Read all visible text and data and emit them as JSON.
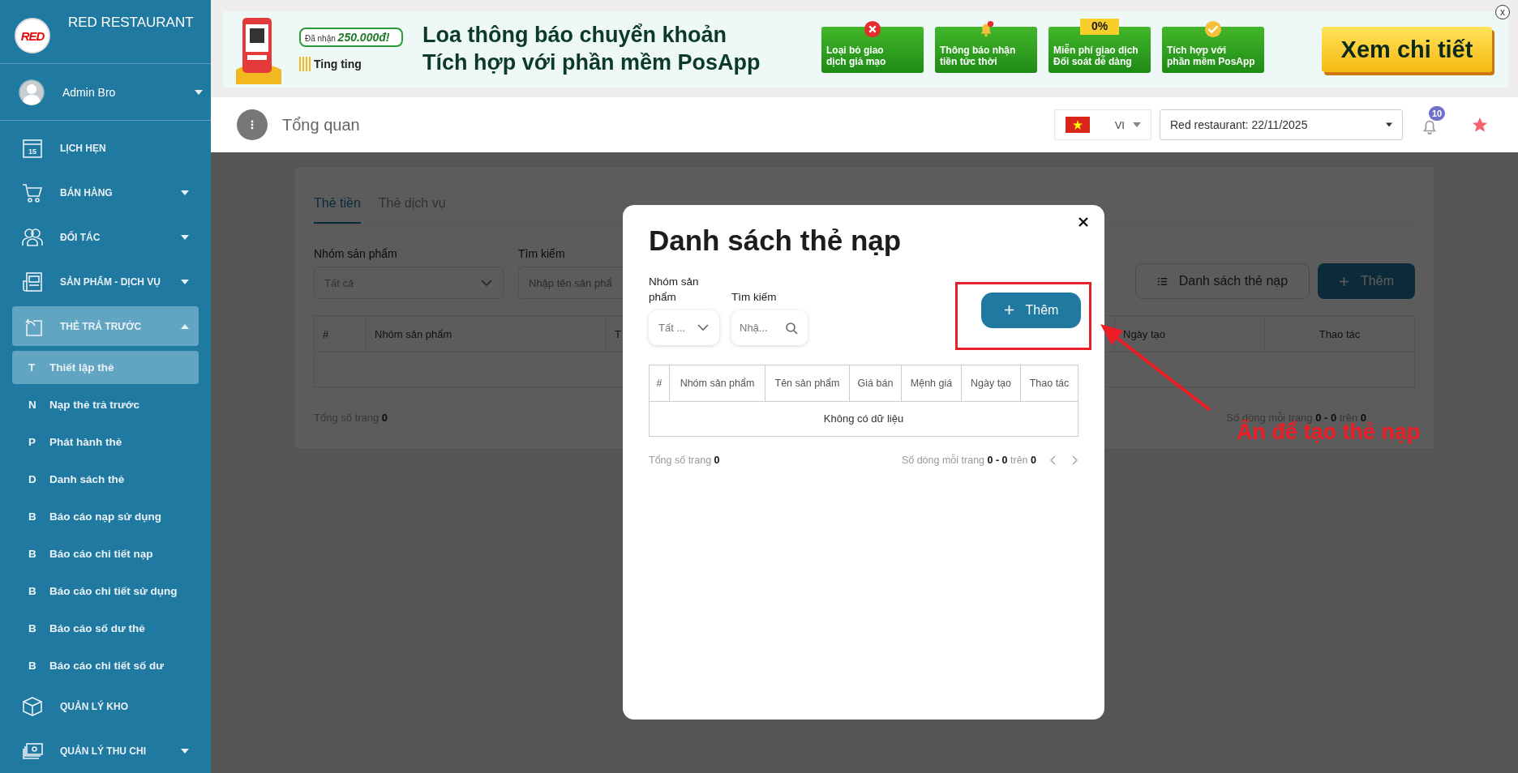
{
  "sidebar": {
    "logo": "RED",
    "brand": "RED RESTAURANT",
    "user": {
      "name": "Admin Bro"
    },
    "items": [
      {
        "kind": "link",
        "label": "LỊCH HẸN",
        "icon_text": "15",
        "selected": false
      },
      {
        "kind": "group",
        "label": "BÁN HÀNG",
        "expanded": false,
        "selected": false
      },
      {
        "kind": "group",
        "label": "ĐỐI TÁC",
        "expanded": false,
        "selected": false
      },
      {
        "kind": "group",
        "label": "SẢN PHẨM - DỊCH VỤ",
        "expanded": false,
        "selected": false
      },
      {
        "kind": "group",
        "label": "THẺ TRẢ TRƯỚC",
        "expanded": true,
        "selected": true,
        "children": [
          {
            "letter": "T",
            "label": "Thiết lập thẻ",
            "selected": true
          },
          {
            "letter": "N",
            "label": "Nạp thẻ trả trước",
            "selected": false
          },
          {
            "letter": "P",
            "label": "Phát hành thẻ",
            "selected": false
          },
          {
            "letter": "D",
            "label": "Danh sách thẻ",
            "selected": false
          },
          {
            "letter": "B",
            "label": "Báo cáo nạp sử dụng",
            "selected": false
          },
          {
            "letter": "B",
            "label": "Báo cáo chi tiết nạp",
            "selected": false
          },
          {
            "letter": "B",
            "label": "Báo cáo chi tiết sử dụng",
            "selected": false
          },
          {
            "letter": "B",
            "label": "Báo cáo số dư thẻ",
            "selected": false
          },
          {
            "letter": "B",
            "label": "Báo cáo chi tiết số dư",
            "selected": false
          }
        ]
      },
      {
        "kind": "link",
        "label": "QUẢN LÝ KHO",
        "selected": false
      },
      {
        "kind": "group",
        "label": "QUẢN LÝ THU CHI",
        "expanded": false,
        "selected": false
      }
    ]
  },
  "banner": {
    "pill": "Đã nhận **250.000đ!**",
    "brand": "Ting ting",
    "headline": [
      "Loa thông báo chuyển khoản",
      "Tích hợp với phần mềm PosApp"
    ],
    "features": [
      {
        "kind": "reject",
        "text": "Loại bỏ giao\ndịch giả mạo"
      },
      {
        "kind": "bell",
        "text": "Thông báo nhận\ntiền tức thời"
      },
      {
        "kind": "tag",
        "tag": "0%",
        "text": "Miễn phí giao dịch\nĐối soát dễ dàng"
      },
      {
        "kind": "check",
        "text": "Tích hợp với\nphần mềm PosApp"
      }
    ],
    "cta": "Xem chi tiết",
    "close": "x"
  },
  "header": {
    "title": "Tổng quan",
    "language": "VI",
    "store": "Red restaurant: 22/11/2025",
    "notifications": "10"
  },
  "page": {
    "tabs": [
      {
        "label": "Thẻ tiền",
        "selected": true
      },
      {
        "label": "Thẻ dịch vụ",
        "selected": false
      }
    ],
    "filters": [
      {
        "kind": "select",
        "label": "Nhóm sản phẩm",
        "value": "Tất cả"
      },
      {
        "kind": "search",
        "label": "Tìm kiếm",
        "placeholder": "Nhập tên sản phẩ"
      }
    ],
    "buttons": [
      {
        "kind": "outline",
        "label": "Danh sách thẻ nạp"
      },
      {
        "kind": "primary",
        "label": "Thêm"
      }
    ],
    "columns": [
      "#",
      "Nhóm sản phẩm",
      "T",
      "Ngày tạo",
      "Thao tác"
    ],
    "total": "Tổng số trang **0**",
    "pager": "Số dòng mỗi trang **0 - 0** trên **0**"
  },
  "modal": {
    "title": "Danh sách thẻ nạp",
    "filters": [
      {
        "kind": "select",
        "label": "Nhóm sản phẩm",
        "value": "Tất ..."
      },
      {
        "kind": "search",
        "label": "Tìm kiếm",
        "placeholder": "Nhậ..."
      }
    ],
    "add_button": "Thêm",
    "columns": [
      "#",
      "Nhóm sản phẩm",
      "Tên sản phẩm",
      "Giá bán",
      "Mệnh giá",
      "Ngày tạo",
      "Thao tác"
    ],
    "empty": "Không có dữ liệu",
    "total": "Tổng số trang **0**",
    "pager": "Số dòng mỗi trang **0 - 0** trên **0**"
  },
  "annotation": {
    "text": "Ấn để tạo thẻ nạp"
  }
}
